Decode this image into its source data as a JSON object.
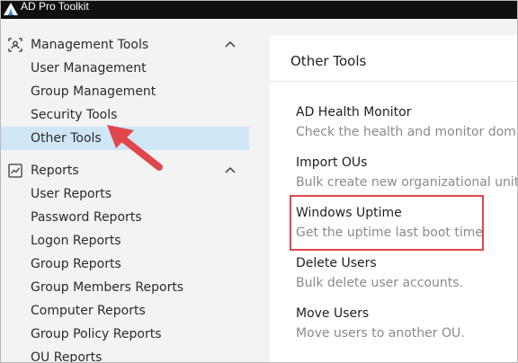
{
  "app": {
    "title": "AD Pro Toolkit"
  },
  "sidebar": {
    "sections": [
      {
        "label": "Management Tools",
        "icon": "user-scan-icon",
        "items": [
          {
            "label": "User Management"
          },
          {
            "label": "Group Management"
          },
          {
            "label": "Security Tools"
          },
          {
            "label": "Other Tools",
            "selected": true
          }
        ]
      },
      {
        "label": "Reports",
        "icon": "chart-icon",
        "items": [
          {
            "label": "User Reports"
          },
          {
            "label": "Password Reports"
          },
          {
            "label": "Logon Reports"
          },
          {
            "label": "Group Reports"
          },
          {
            "label": "Group Members Reports"
          },
          {
            "label": "Computer Reports"
          },
          {
            "label": "Group Policy Reports"
          },
          {
            "label": "OU Reports"
          }
        ]
      }
    ]
  },
  "main": {
    "title": "Other Tools",
    "tools": [
      {
        "title": "AD Health Monitor",
        "description": "Check the health and monitor domain"
      },
      {
        "title": "Import OUs",
        "description": "Bulk create new organizational units."
      },
      {
        "title": "Windows Uptime",
        "description": "Get the uptime  last boot time"
      },
      {
        "title": "Delete Users",
        "description": "Bulk delete user accounts."
      },
      {
        "title": "Move Users",
        "description": "Move users to another OU."
      }
    ]
  },
  "colors": {
    "selected_bg": "#cfe6f7",
    "annotation_red": "#e0474c",
    "title_bar": "#101010"
  }
}
